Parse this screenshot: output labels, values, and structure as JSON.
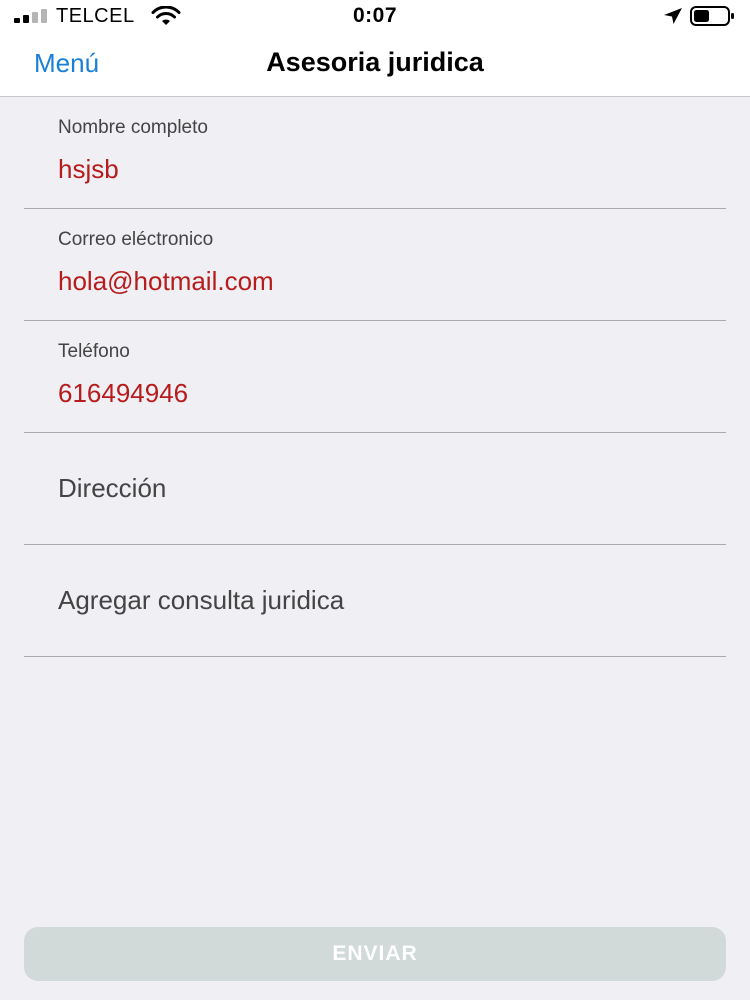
{
  "status_bar": {
    "carrier": "TELCEL",
    "time": "0:07",
    "icons": [
      "signal-icon",
      "wifi-icon",
      "location-arrow-icon",
      "battery-icon"
    ]
  },
  "nav": {
    "back_label": "Menú",
    "title": "Asesoria juridica",
    "accent_color": "#1a7fd9"
  },
  "form": {
    "value_color": "#b71c1c",
    "fields": [
      {
        "label": "Nombre completo",
        "value": "hsjsb"
      },
      {
        "label": "Correo eléctronico",
        "value": "hola@hotmail.com"
      },
      {
        "label": "Teléfono",
        "value": "616494946"
      },
      {
        "placeholder": "Dirección"
      },
      {
        "placeholder": "Agregar consulta juridica"
      }
    ],
    "submit_label": "ENVIAR"
  }
}
